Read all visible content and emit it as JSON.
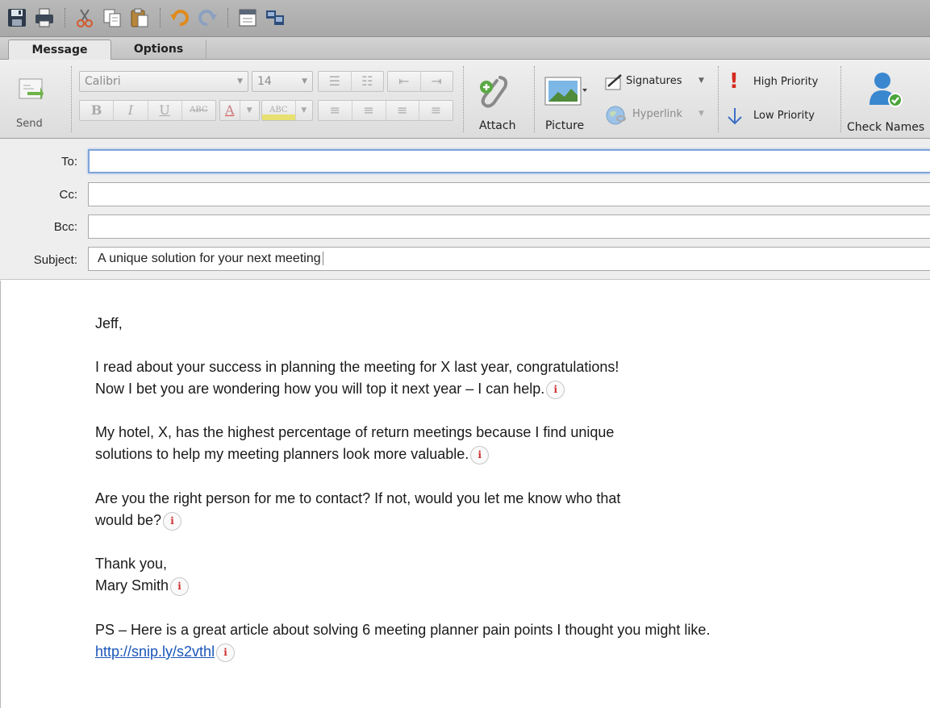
{
  "tabs": {
    "message": "Message",
    "options": "Options"
  },
  "ribbon": {
    "send": "Send",
    "font_name": "Calibri",
    "font_size": "14",
    "attach": "Attach",
    "picture": "Picture",
    "signatures": "Signatures",
    "hyperlink": "Hyperlink",
    "high_priority": "High Priority",
    "low_priority": "Low Priority",
    "check_names": "Check Names"
  },
  "fields": {
    "to_label": "To:",
    "cc_label": "Cc:",
    "bcc_label": "Bcc:",
    "subject_label": "Subject:",
    "to_value": "",
    "cc_value": "",
    "bcc_value": "",
    "subject_value": "A unique solution for your next meeting"
  },
  "body": {
    "greeting": "Jeff,",
    "p1_line1": "I read about your success in planning the meeting for X last year, congratulations!",
    "p1_line2": "Now I bet you are wondering how you will top it next year – I can help.",
    "p2_line1": "My hotel, X, has the highest percentage of return meetings because I find unique",
    "p2_line2": "solutions to help my meeting planners look more valuable.",
    "p3_line1": "Are you the right person for me to contact?  If not, would you let me know who that",
    "p3_line2": "would be?",
    "closing": "Thank you,",
    "signature": "Mary Smith",
    "ps": "PS – Here is a great article about solving 6 meeting planner pain points I thought you might like.",
    "link": "http://snip.ly/s2vthl",
    "info_glyph": "i"
  },
  "colors": {
    "link": "#1a55b8",
    "focus_border": "#7fa4d8",
    "info_marker": "#d03030",
    "high_priority": "#d42a1e",
    "low_priority": "#3d6fc4"
  }
}
